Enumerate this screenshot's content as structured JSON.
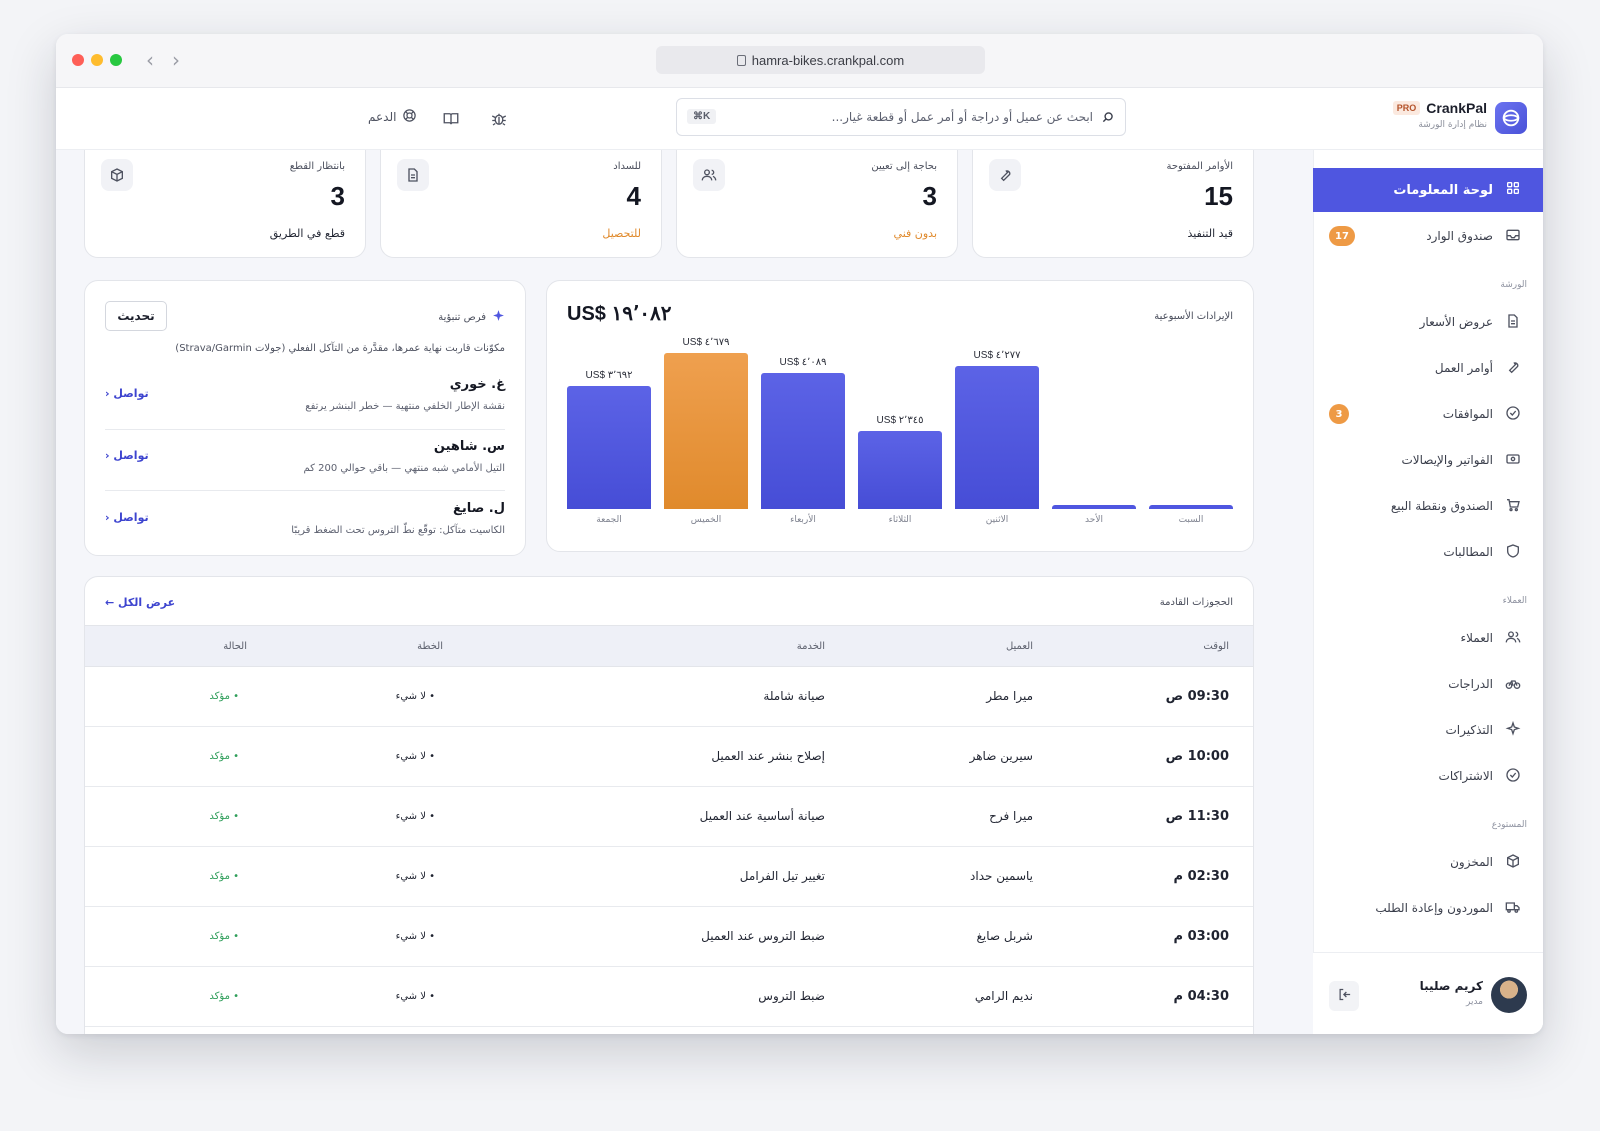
{
  "browser": {
    "url": "hamra-bikes.crankpal.com"
  },
  "brand": {
    "name": "CrankPal",
    "badge": "PRO",
    "subtitle": "نظام إدارة الورشة"
  },
  "header": {
    "search_placeholder": "ابحث عن عميل أو دراجة أو أمر عمل أو قطعة غيار...",
    "search_shortcut": "⌘K",
    "support_label": "الدعم"
  },
  "sidebar": {
    "dashboard": "لوحة المعلومات",
    "inbox": "صندوق الوارد",
    "inbox_badge": "17",
    "section_workshop": "الورشة",
    "quotes": "عروض الأسعار",
    "work_orders": "أوامر العمل",
    "approvals": "الموافقات",
    "approvals_badge": "3",
    "invoices": "الفواتير والإيصالات",
    "pos": "الصندوق ونقطة البيع",
    "claims": "المطالبات",
    "section_customers": "العملاء",
    "customers": "العملاء",
    "bikes": "الدراجات",
    "reminders": "التذكيرات",
    "subscriptions": "الاشتراكات",
    "section_warehouse": "المستودع",
    "inventory": "المخزون",
    "suppliers": "الموردون وإعادة الطلب"
  },
  "user": {
    "name": "كريم صليبا",
    "role": "مدير"
  },
  "stats": [
    {
      "title": "الأوامر المفتوحة",
      "value": "15",
      "sub": "قيد التنفيذ",
      "sub_color": "#1f2330",
      "icon": "wrench-icon"
    },
    {
      "title": "بحاجة إلى تعيين",
      "value": "3",
      "sub": "بدون فني",
      "sub_color": "#e08a2c",
      "icon": "users-icon"
    },
    {
      "title": "للسداد",
      "value": "4",
      "sub": "للتحصيل",
      "sub_color": "#e08a2c",
      "icon": "document-icon"
    },
    {
      "title": "بانتظار القطع",
      "value": "3",
      "sub": "قطع في الطريق",
      "sub_color": "#1f2330",
      "icon": "box-icon"
    }
  ],
  "chart_data": {
    "type": "bar",
    "title": "الإيرادات الأسبوعية",
    "total": "US$ ١٩٬٠٨٢",
    "categories": [
      "السبت",
      "الأحد",
      "الاثنين",
      "الثلاثاء",
      "الأربعاء",
      "الخميس",
      "الجمعة"
    ],
    "values": [
      0,
      0,
      4277,
      2345,
      4089,
      4679,
      3692
    ],
    "value_labels": [
      "",
      "",
      "US$ ٤٬٢٧٧",
      "US$ ٢٬٣٤٥",
      "US$ ٤٬٠٨٩",
      "US$ ٤٬٦٧٩",
      "US$ ٣٬٦٩٢"
    ],
    "highlight_index": 5,
    "colors": {
      "bar": "#4f56e0",
      "highlight": "#e8943e"
    },
    "ylim": [
      0,
      4679
    ]
  },
  "insights": {
    "title": "فرص تنبؤية",
    "refresh_label": "تحديث",
    "description": "مكوّنات قاربت نهاية عمرها، مقدَّرة من التآكل الفعلي (جولات Strava/Garmin)",
    "items": [
      {
        "name": "غ. خوري",
        "desc": "نقشة الإطار الخلفي منتهية — خطر البنشر يرتفع",
        "cta": "تواصل ‹"
      },
      {
        "name": "س. شاهين",
        "desc": "التيل الأمامي شبه منتهي — باقي حوالي 200 كم",
        "cta": "تواصل ‹"
      },
      {
        "name": "ل. صايغ",
        "desc": "الكاسيت متآكل: توقّع نطّ التروس تحت الضغط قريبًا",
        "cta": "تواصل ‹"
      }
    ]
  },
  "bookings": {
    "title": "الحجوزات القادمة",
    "view_all": "عرض الكل ←",
    "columns": {
      "time": "الوقت",
      "customer": "العميل",
      "service": "الخدمة",
      "plan": "الخطة",
      "status": "الحالة"
    },
    "rows": [
      {
        "time": "09:30 ص",
        "customer": "ميرا مطر",
        "service": "صيانة شاملة",
        "plan": "• لا شيء",
        "status": "• مؤكد"
      },
      {
        "time": "10:00 ص",
        "customer": "سيرين ضاهر",
        "service": "إصلاح بنشر عند العميل",
        "plan": "• لا شيء",
        "status": "• مؤكد"
      },
      {
        "time": "11:30 ص",
        "customer": "ميرا فرح",
        "service": "صيانة أساسية عند العميل",
        "plan": "• لا شيء",
        "status": "• مؤكد"
      },
      {
        "time": "02:30 م",
        "customer": "ياسمين حداد",
        "service": "تغيير تيل الفرامل",
        "plan": "• لا شيء",
        "status": "• مؤكد"
      },
      {
        "time": "03:00 م",
        "customer": "شربل صايغ",
        "service": "ضبط التروس عند العميل",
        "plan": "• لا شيء",
        "status": "• مؤكد"
      },
      {
        "time": "04:30 م",
        "customer": "نديم الرامي",
        "service": "ضبط التروس",
        "plan": "• لا شيء",
        "status": "• مؤكد"
      }
    ]
  }
}
